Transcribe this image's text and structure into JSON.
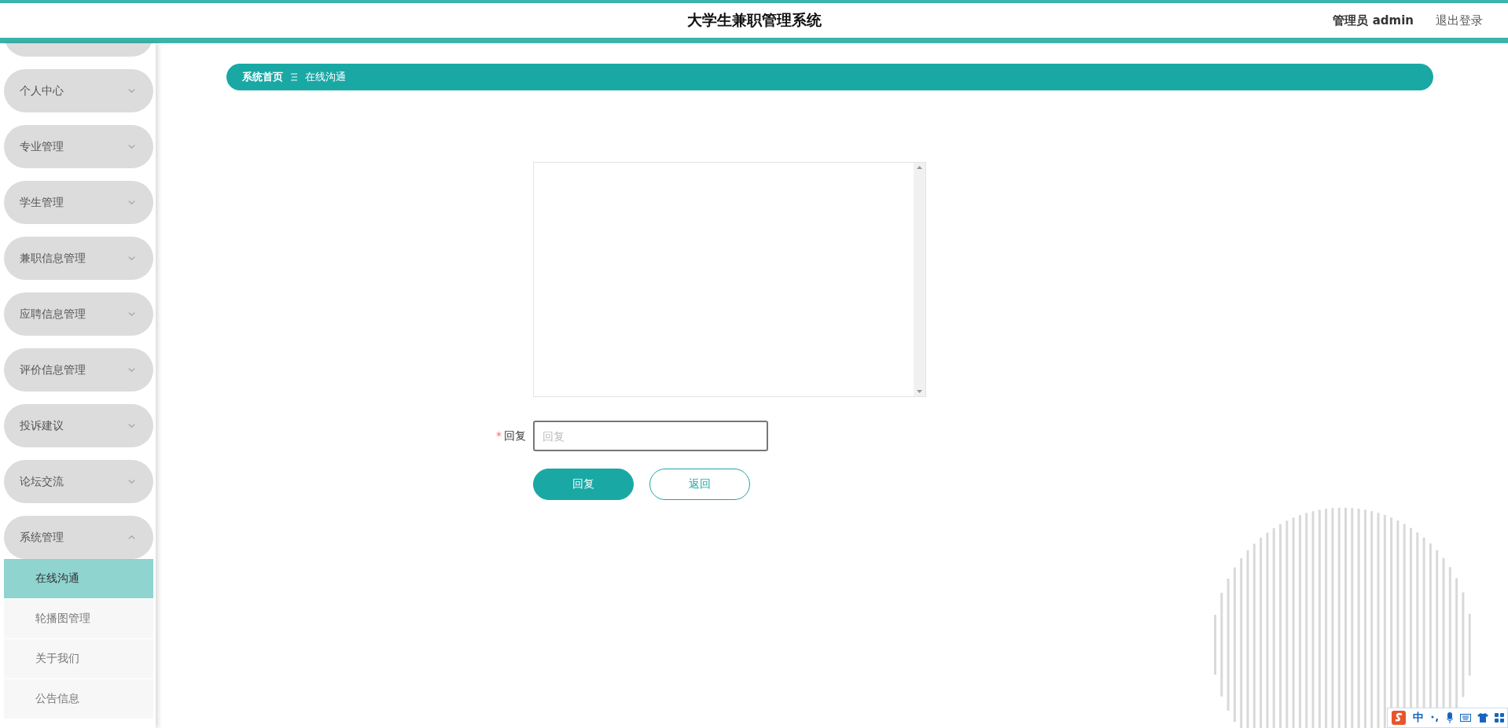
{
  "header": {
    "title": "大学生兼职管理系统",
    "user": "管理员 admin",
    "logout": "退出登录"
  },
  "sidebar": {
    "items": [
      {
        "label": "个人中心",
        "expanded": false
      },
      {
        "label": "专业管理",
        "expanded": false
      },
      {
        "label": "学生管理",
        "expanded": false
      },
      {
        "label": "兼职信息管理",
        "expanded": false
      },
      {
        "label": "应聘信息管理",
        "expanded": false
      },
      {
        "label": "评价信息管理",
        "expanded": false
      },
      {
        "label": "投诉建议",
        "expanded": false
      },
      {
        "label": "论坛交流",
        "expanded": false
      },
      {
        "label": "系统管理",
        "expanded": true,
        "children": [
          {
            "label": "在线沟通",
            "selected": true
          },
          {
            "label": "轮播图管理",
            "selected": false
          },
          {
            "label": "关于我们",
            "selected": false
          },
          {
            "label": "公告信息",
            "selected": false
          }
        ]
      }
    ]
  },
  "breadcrumb": [
    "系统首页",
    "在线沟通"
  ],
  "form": {
    "reply_label": "回复",
    "required_mark": "*",
    "reply_placeholder": "回复",
    "buttons": [
      {
        "label": "回复",
        "kind": "primary"
      },
      {
        "label": "返回",
        "kind": "outline"
      }
    ]
  },
  "ime_bar": {
    "mode": "中"
  }
}
